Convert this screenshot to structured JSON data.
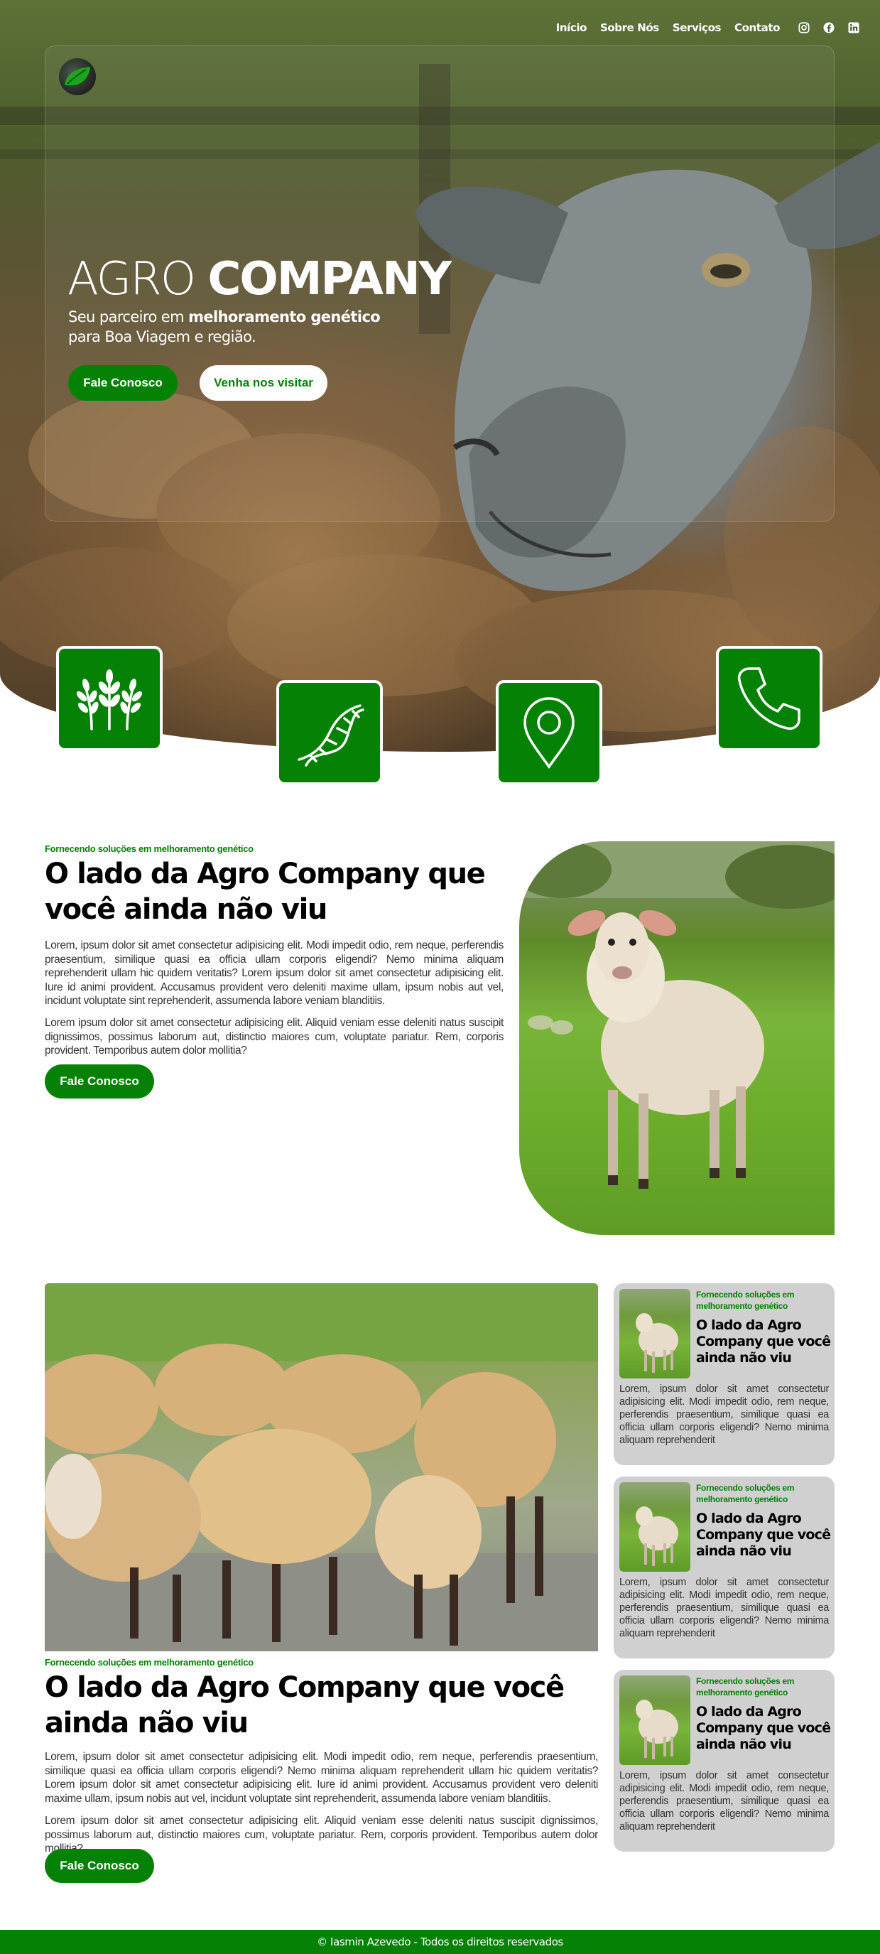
{
  "nav": {
    "links": [
      "Início",
      "Sobre Nós",
      "Serviços",
      "Contato"
    ],
    "social": [
      "instagram-icon",
      "facebook-icon",
      "linkedin-icon"
    ]
  },
  "hero": {
    "title_light": "AGRO ",
    "title_bold": "COMPANY",
    "subtitle_pre": "Seu parceiro em ",
    "subtitle_bold": "melhoramento genético",
    "subtitle_post": "para Boa Viagem e região.",
    "btn_contact": "Fale Conosco",
    "btn_visit": "Venha nos visitar"
  },
  "features": [
    "wheat-icon",
    "dna-icon",
    "location-pin-icon",
    "phone-icon"
  ],
  "about": {
    "eyebrow": "Fornecendo soluções em melhoramento genético",
    "title": "O lado da Agro Company que você ainda não viu",
    "p1": "Lorem, ipsum dolor sit amet consectetur adipisicing elit. Modi impedit odio, rem neque, perferendis praesentium, similique quasi ea officia ullam corporis eligendi? Nemo minima aliquam reprehenderit ullam hic quidem veritatis? Lorem ipsum dolor sit amet consectetur adipisicing elit. Iure id animi provident. Accusamus provident vero deleniti maxime ullam, ipsum nobis aut vel, incidunt voluptate sint reprehenderit, assumenda labore veniam blanditiis.",
    "p2": "Lorem ipsum dolor sit amet consectetur adipisicing elit. Aliquid veniam esse deleniti natus suscipit dignissimos, possimus laborum aut, distinctio maiores cum, voluptate pariatur. Rem, corporis provident. Temporibus autem dolor mollitia?",
    "btn": "Fale Conosco"
  },
  "feature_main": {
    "eyebrow": "Fornecendo soluções em melhoramento genético",
    "title": "O lado da Agro Company que você ainda não viu",
    "p1": "Lorem, ipsum dolor sit amet consectetur adipisicing elit. Modi impedit odio, rem neque, perferendis praesentium, similique quasi ea officia ullam corporis eligendi? Nemo minima aliquam reprehenderit ullam hic quidem veritatis? Lorem ipsum dolor sit amet consectetur adipisicing elit. Iure id animi provident. Accusamus provident vero deleniti maxime ullam, ipsum nobis aut vel, incidunt voluptate sint reprehenderit, assumenda labore veniam blanditiis.",
    "p2": "Lorem ipsum dolor sit amet consectetur adipisicing elit. Aliquid veniam esse deleniti natus suscipit dignissimos, possimus laborum aut, distinctio maiores cum, voluptate pariatur. Rem, corporis provident. Temporibus autem dolor mollitia?",
    "btn": "Fale Conosco"
  },
  "cards": [
    {
      "eyebrow": "Fornecendo soluções em melhoramento genético",
      "title": "O lado da Agro Company que você ainda não viu",
      "text": "Lorem, ipsum dolor sit amet consectetur adipisicing elit. Modi impedit odio, rem neque, perferendis praesentium, similique quasi ea officia ullam corporis eligendi? Nemo minima aliquam reprehenderit"
    },
    {
      "eyebrow": "Fornecendo soluções em melhoramento genético",
      "title": "O lado da Agro Company que você ainda não viu",
      "text": "Lorem, ipsum dolor sit amet consectetur adipisicing elit. Modi impedit odio, rem neque, perferendis praesentium, similique quasi ea officia ullam corporis eligendi? Nemo minima aliquam reprehenderit"
    },
    {
      "eyebrow": "Fornecendo soluções em melhoramento genético",
      "title": "O lado da Agro Company que você ainda não viu",
      "text": "Lorem, ipsum dolor sit amet consectetur adipisicing elit. Modi impedit odio, rem neque, perferendis praesentium, similique quasi ea officia ullam corporis eligendi? Nemo minima aliquam reprehenderit"
    }
  ],
  "footer": {
    "text": "© Iasmin Azevedo - Todos os direitos reservados"
  },
  "colors": {
    "brand_green": "#058205",
    "card_bg": "#d0d0d0"
  }
}
